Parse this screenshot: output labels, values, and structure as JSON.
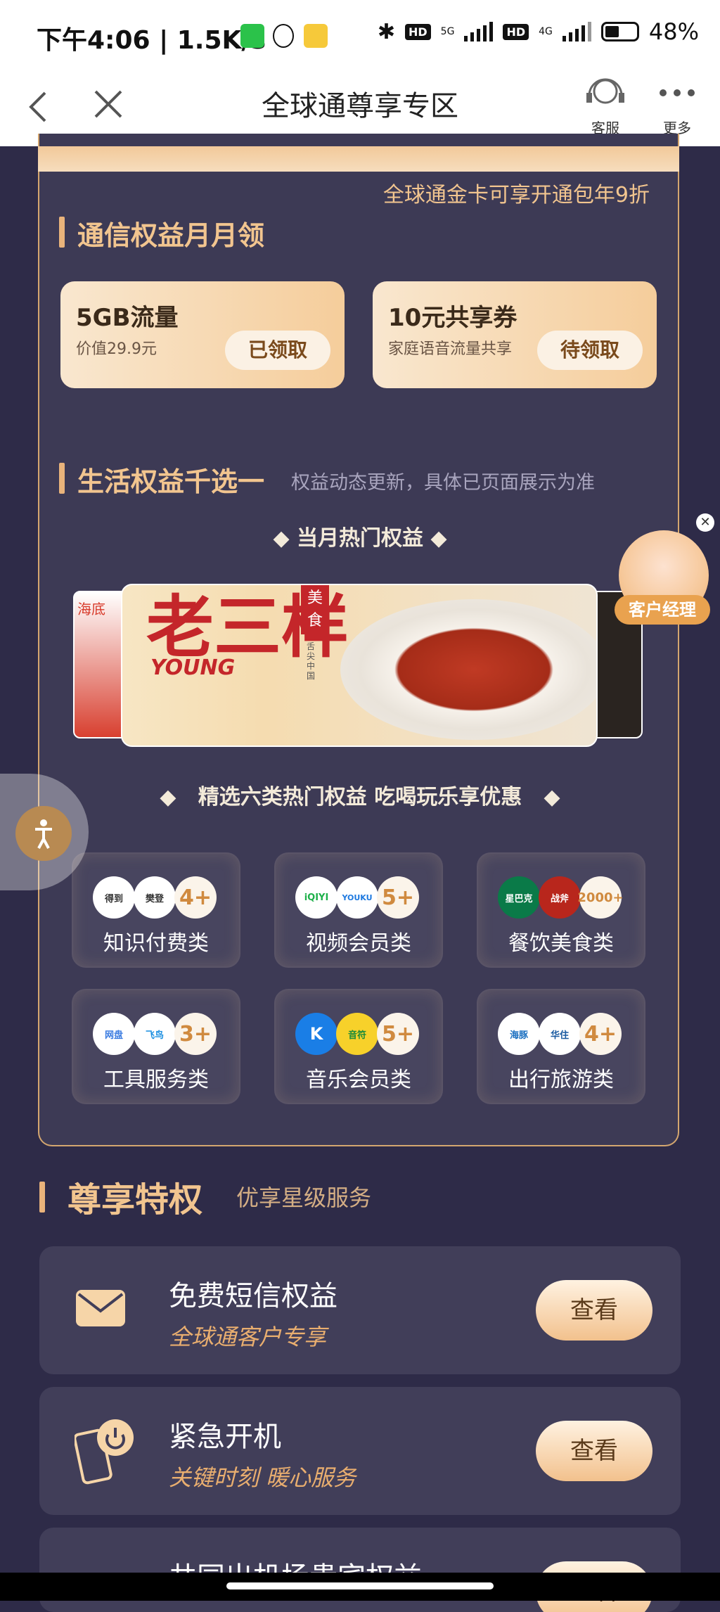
{
  "status_bar": {
    "time": "下午4:06 | 1.5K/s",
    "net_5g": "5G",
    "net_4g": "4G",
    "hd": "HD",
    "battery": "48%"
  },
  "nav": {
    "title": "全球通尊享专区",
    "service_label": "客服",
    "more_label": "更多"
  },
  "top_note": "全球通金卡可享开通包年9折",
  "telecom_section": {
    "title": "通信权益月月领",
    "cards": [
      {
        "title": "5GB流量",
        "subtitle": "价值29.9元",
        "button": "已领取"
      },
      {
        "title": "10元共享券",
        "subtitle": "家庭语音流量共享",
        "button": "待领取"
      }
    ]
  },
  "life_section": {
    "title": "生活权益千选一",
    "note": "权益动态更新，具体已页面展示为准",
    "hot_title": "◆ 当月热门权益 ◆",
    "banner": {
      "big_text": "老三样",
      "latin_text": "YOUNG",
      "tag": "美食",
      "tag_sub": "舌尖中国",
      "left_peek": "海底"
    },
    "categories_title": "精选六类热门权益 吃喝玩乐享优惠",
    "categories": [
      {
        "label": "知识付费类",
        "logos": [
          "得到",
          "樊登"
        ],
        "count": "4+"
      },
      {
        "label": "视频会员类",
        "logos": [
          "iQIYI",
          "YOUKU"
        ],
        "count": "5+"
      },
      {
        "label": "餐饮美食类",
        "logos": [
          "星巴克",
          "战斧"
        ],
        "count": "2000+"
      },
      {
        "label": "工具服务类",
        "logos": [
          "网盘",
          "飞鸟"
        ],
        "count": "3+"
      },
      {
        "label": "音乐会员类",
        "logos": [
          "K",
          "音符"
        ],
        "count": "5+"
      },
      {
        "label": "出行旅游类",
        "logos": [
          "海豚",
          "华住"
        ],
        "count": "4+"
      }
    ]
  },
  "manager_float": {
    "label": "客户经理"
  },
  "privilege_section": {
    "title": "尊享特权",
    "subtitle": "优享星级服务",
    "items": [
      {
        "title": "免费短信权益",
        "subtitle": "全球通客户专享",
        "button": "查看",
        "icon": "envelope-icon"
      },
      {
        "title": "紧急开机",
        "subtitle": "关键时刻 暖心服务",
        "button": "查看",
        "icon": "phone-power-icon"
      },
      {
        "title": "共同出机场贵宾权益",
        "subtitle": "",
        "button": "查看",
        "icon": "plane-icon"
      }
    ]
  },
  "colors": {
    "accent": "#f2c58f",
    "background": "#2e2b48",
    "card": "#3d3a55"
  }
}
